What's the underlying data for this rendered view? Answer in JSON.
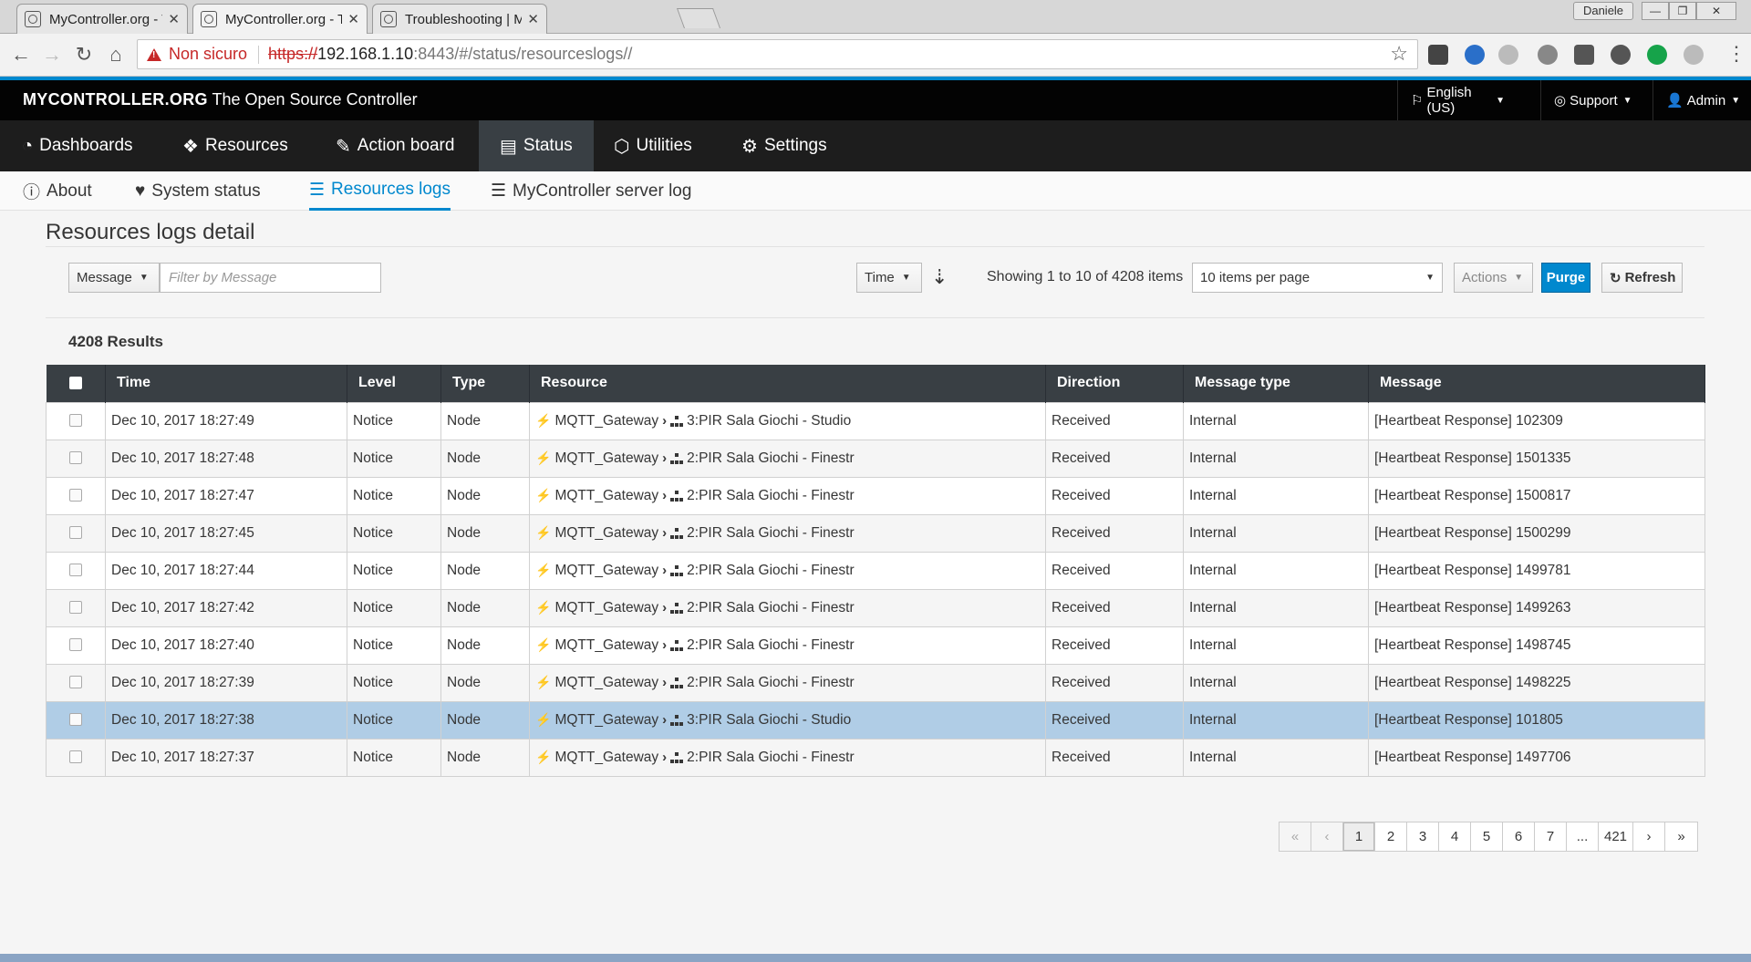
{
  "browser": {
    "tabs": [
      {
        "label": "MyController.org - The O"
      },
      {
        "label": "MyController.org - The C"
      },
      {
        "label": "Troubleshooting | MyCon"
      }
    ],
    "user": "Daniele",
    "security_label": "Non sicuro",
    "url_scheme": "https://",
    "url_host": "192.168.1.10",
    "url_rest": ":8443/#/status/resourceslogs//"
  },
  "header": {
    "brand_bold": "MYCONTROLLER.ORG",
    "brand_rest": "The Open Source Controller",
    "language": "English (US)",
    "support": "Support",
    "admin": "Admin"
  },
  "mainnav": [
    {
      "label": "Dashboards"
    },
    {
      "label": "Resources"
    },
    {
      "label": "Action board"
    },
    {
      "label": "Status"
    },
    {
      "label": "Utilities"
    },
    {
      "label": "Settings"
    }
  ],
  "subnav": [
    {
      "label": "About"
    },
    {
      "label": "System status"
    },
    {
      "label": "Resources logs"
    },
    {
      "label": "MyController server log"
    }
  ],
  "page": {
    "title": "Resources logs detail",
    "filter_field": "Message",
    "filter_placeholder": "Filter by Message",
    "sort_field": "Time",
    "showing": "Showing 1 to 10 of 4208 items",
    "per_page": "10 items per page",
    "actions": "Actions",
    "purge": "Purge",
    "refresh": "Refresh",
    "results": "4208 Results"
  },
  "table": {
    "headers": [
      "Time",
      "Level",
      "Type",
      "Resource",
      "Direction",
      "Message type",
      "Message"
    ],
    "rows": [
      {
        "time": "Dec 10, 2017 18:27:49",
        "level": "Notice",
        "type": "Node",
        "gateway": "MQTT_Gateway",
        "node": "3:PIR Sala Giochi - Studio",
        "direction": "Received",
        "msgtype": "Internal",
        "message": "[Heartbeat Response] 102309"
      },
      {
        "time": "Dec 10, 2017 18:27:48",
        "level": "Notice",
        "type": "Node",
        "gateway": "MQTT_Gateway",
        "node": "2:PIR Sala Giochi - Finestr",
        "direction": "Received",
        "msgtype": "Internal",
        "message": "[Heartbeat Response] 1501335"
      },
      {
        "time": "Dec 10, 2017 18:27:47",
        "level": "Notice",
        "type": "Node",
        "gateway": "MQTT_Gateway",
        "node": "2:PIR Sala Giochi - Finestr",
        "direction": "Received",
        "msgtype": "Internal",
        "message": "[Heartbeat Response] 1500817"
      },
      {
        "time": "Dec 10, 2017 18:27:45",
        "level": "Notice",
        "type": "Node",
        "gateway": "MQTT_Gateway",
        "node": "2:PIR Sala Giochi - Finestr",
        "direction": "Received",
        "msgtype": "Internal",
        "message": "[Heartbeat Response] 1500299"
      },
      {
        "time": "Dec 10, 2017 18:27:44",
        "level": "Notice",
        "type": "Node",
        "gateway": "MQTT_Gateway",
        "node": "2:PIR Sala Giochi - Finestr",
        "direction": "Received",
        "msgtype": "Internal",
        "message": "[Heartbeat Response] 1499781"
      },
      {
        "time": "Dec 10, 2017 18:27:42",
        "level": "Notice",
        "type": "Node",
        "gateway": "MQTT_Gateway",
        "node": "2:PIR Sala Giochi - Finestr",
        "direction": "Received",
        "msgtype": "Internal",
        "message": "[Heartbeat Response] 1499263"
      },
      {
        "time": "Dec 10, 2017 18:27:40",
        "level": "Notice",
        "type": "Node",
        "gateway": "MQTT_Gateway",
        "node": "2:PIR Sala Giochi - Finestr",
        "direction": "Received",
        "msgtype": "Internal",
        "message": "[Heartbeat Response] 1498745"
      },
      {
        "time": "Dec 10, 2017 18:27:39",
        "level": "Notice",
        "type": "Node",
        "gateway": "MQTT_Gateway",
        "node": "2:PIR Sala Giochi - Finestr",
        "direction": "Received",
        "msgtype": "Internal",
        "message": "[Heartbeat Response] 1498225"
      },
      {
        "time": "Dec 10, 2017 18:27:38",
        "level": "Notice",
        "type": "Node",
        "gateway": "MQTT_Gateway",
        "node": "3:PIR Sala Giochi - Studio",
        "direction": "Received",
        "msgtype": "Internal",
        "message": "[Heartbeat Response] 101805"
      },
      {
        "time": "Dec 10, 2017 18:27:37",
        "level": "Notice",
        "type": "Node",
        "gateway": "MQTT_Gateway",
        "node": "2:PIR Sala Giochi - Finestr",
        "direction": "Received",
        "msgtype": "Internal",
        "message": "[Heartbeat Response] 1497706"
      }
    ]
  },
  "pagination": [
    "«",
    "‹",
    "1",
    "2",
    "3",
    "4",
    "5",
    "6",
    "7",
    "...",
    "421",
    "›",
    "»"
  ],
  "colors": {
    "accent": "#0088ce",
    "header": "#030303",
    "nav": "#1d1d1d",
    "selected_row": "#b0cde6"
  }
}
